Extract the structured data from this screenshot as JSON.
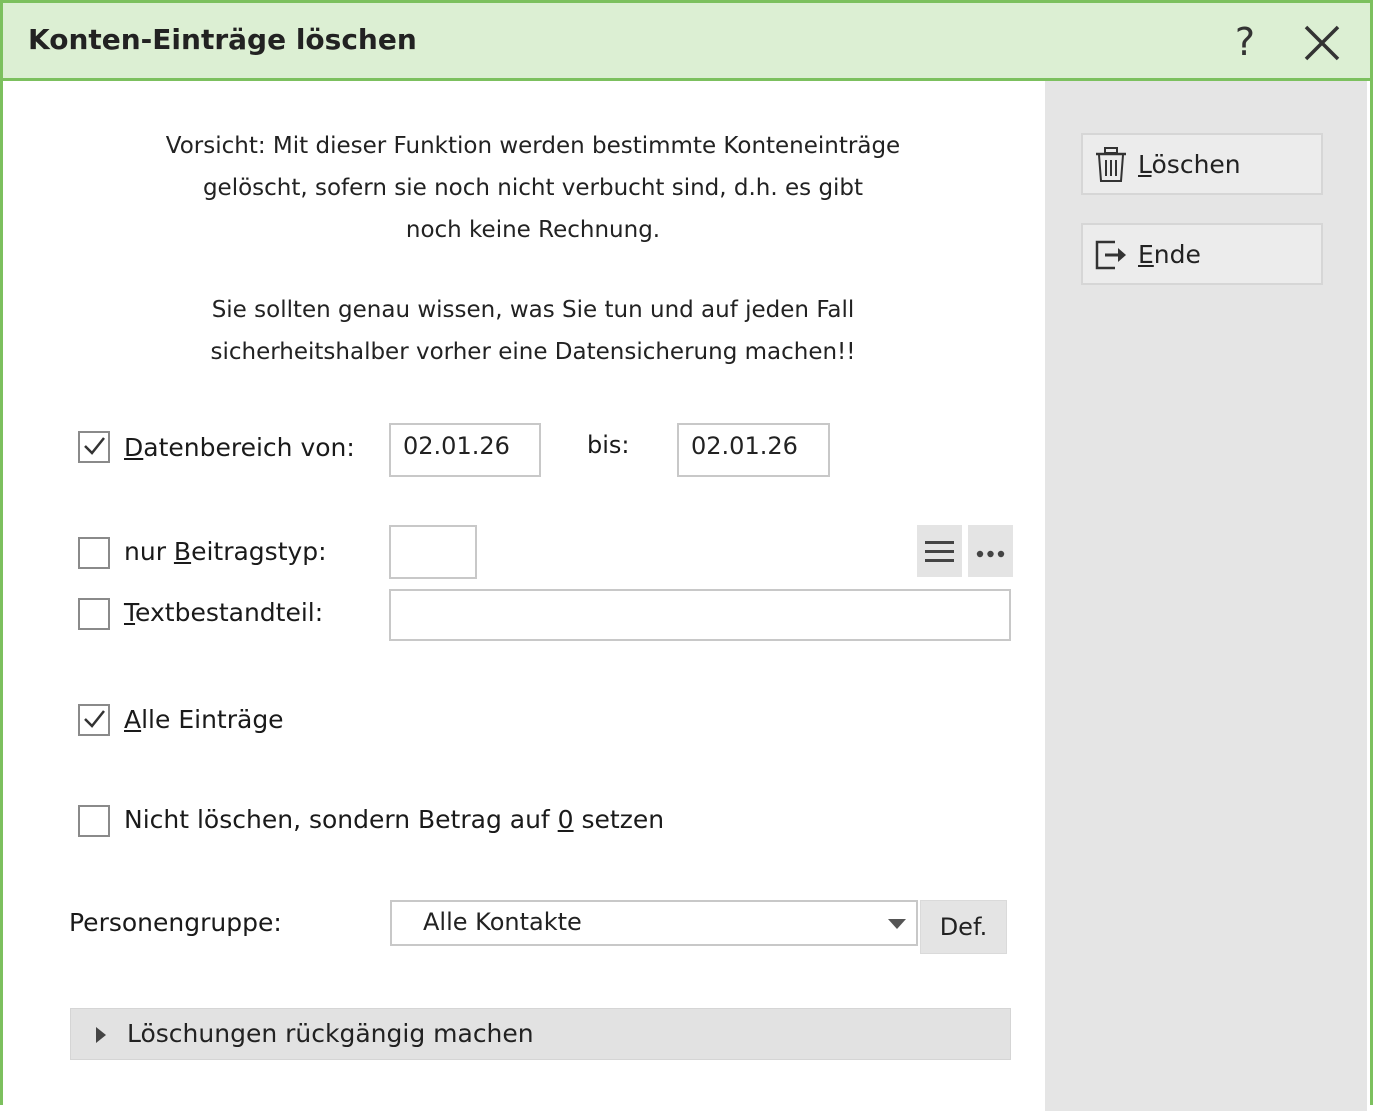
{
  "window": {
    "title": "Konten-Einträge löschen",
    "help_glyph": "?"
  },
  "sidebar": {
    "delete_mnemonic": "L",
    "delete_rest": "öschen",
    "end_mnemonic": "E",
    "end_rest": "nde"
  },
  "warning": {
    "line1": "Vorsicht: Mit dieser Funktion werden bestimmte Konteneinträge",
    "line2": "gelöscht, sofern sie noch nicht verbucht sind, d.h. es gibt",
    "line3": "noch keine Rechnung.",
    "line4": "Sie sollten genau wissen, was Sie tun und auf jeden Fall",
    "line5": "sicherheitshalber vorher eine Datensicherung machen!!"
  },
  "date_range": {
    "checked": true,
    "label_mnemonic": "D",
    "label_rest": "atenbereich von:",
    "from_value": "02.01.26",
    "to_label": "bis:",
    "to_value": "02.01.26"
  },
  "contribution_type": {
    "checked": false,
    "label_prefix": "nur ",
    "label_mnemonic": "B",
    "label_rest": "eitragstyp:",
    "value": ""
  },
  "text_part": {
    "checked": false,
    "label_mnemonic": "T",
    "label_rest": "extbestandteil:",
    "value": ""
  },
  "all_entries": {
    "checked": true,
    "label_mnemonic": "A",
    "label_rest": "lle Einträge"
  },
  "zero_amount": {
    "checked": false,
    "label_prefix": "Nicht löschen, sondern Betrag auf ",
    "label_mnemonic": "0",
    "label_rest": " setzen"
  },
  "person_group": {
    "label": "Personengruppe:",
    "selected": "Alle Kontakte",
    "def_label": "Def."
  },
  "undo_section": {
    "label": "Löschungen rückgängig machen",
    "expanded": false
  },
  "colors": {
    "accent": "#7cc05e",
    "titlebar_bg": "#dcefd3",
    "sidebar_bg": "#e5e5e5"
  }
}
